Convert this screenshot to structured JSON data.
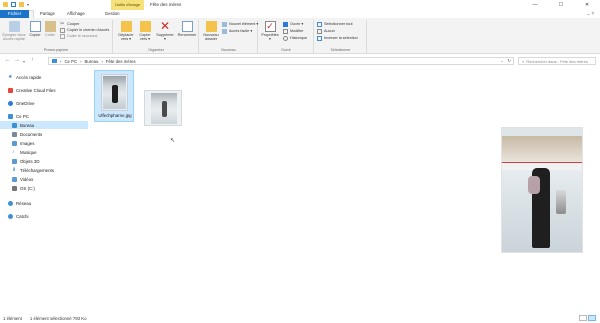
{
  "window": {
    "title": "Fête des mères",
    "context_tab_title": "Outils d'image",
    "controls": {
      "minimize": "—",
      "maximize": "☐",
      "close": "✕"
    }
  },
  "tabs": [
    {
      "label": "Fichier"
    },
    {
      "label": "Accueil"
    },
    {
      "label": "Partage"
    },
    {
      "label": "Affichage"
    },
    {
      "label": "Gestion"
    }
  ],
  "ribbon": {
    "clipboard": {
      "pin_label": "Épingler dans Accès rapide",
      "copy_label": "Copier",
      "paste_label": "Coller",
      "cut_label": "Couper",
      "copy_path_label": "Copier le chemin d'accès",
      "paste_shortcut_label": "Coller le raccourci",
      "group_label": "Presse-papiers"
    },
    "organize": {
      "move_label": "Déplacer vers ▾",
      "copy_to_label": "Copier vers ▾",
      "delete_label": "Supprimer ▾",
      "rename_label": "Renommer",
      "group_label": "Organiser"
    },
    "new": {
      "new_folder_label": "Nouveau dossier",
      "new_item_label": "Nouvel élément ▾",
      "easy_access_label": "Accès facile ▾",
      "group_label": "Nouveau"
    },
    "open": {
      "properties_label": "Propriétés ▾",
      "open_label": "Ouvrir ▾",
      "edit_label": "Modifier",
      "history_label": "Historique",
      "group_label": "Ouvrir"
    },
    "select": {
      "select_all_label": "Sélectionner tout",
      "select_none_label": "Aucun",
      "invert_label": "Inverser la sélection",
      "group_label": "Sélectionner"
    }
  },
  "address": {
    "path": [
      "Ce PC",
      "Bureau",
      "Fête des mères"
    ],
    "search_placeholder": "Rechercher dans : Fête des mères"
  },
  "nav": {
    "items": [
      {
        "label": "Accès rapide",
        "color": "#2b7bd8"
      },
      {
        "label": "Creative Cloud Files",
        "color": "#e8453c"
      },
      {
        "label": "OneDrive",
        "color": "#2b7bd8"
      },
      {
        "label": "Ce PC",
        "color": "#3d8fd6"
      },
      {
        "label": "Bureau",
        "color": "#3d8fd6"
      },
      {
        "label": "Documents",
        "color": "#7a8a99"
      },
      {
        "label": "Images",
        "color": "#5a9bd5"
      },
      {
        "label": "Musique",
        "color": "#5a9bd5"
      },
      {
        "label": "Objets 3D",
        "color": "#5a9bd5"
      },
      {
        "label": "Téléchargements",
        "color": "#3d8fd6"
      },
      {
        "label": "Vidéos",
        "color": "#5a9bd5"
      },
      {
        "label": "OS (C:)",
        "color": "#777777"
      },
      {
        "label": "Réseau",
        "color": "#3d8fd6"
      },
      {
        "label": "Catchi",
        "color": "#3d8fd6"
      }
    ]
  },
  "files": [
    {
      "name": "Ulfechpharne.jpg",
      "selected": true
    }
  ],
  "status": {
    "count": "1 élément",
    "selected": "1 élément sélectionné 793 Ko"
  },
  "colors": {
    "accent": "#1c74c9",
    "selection": "#cce8ff",
    "context_tab": "#f6e27a"
  }
}
